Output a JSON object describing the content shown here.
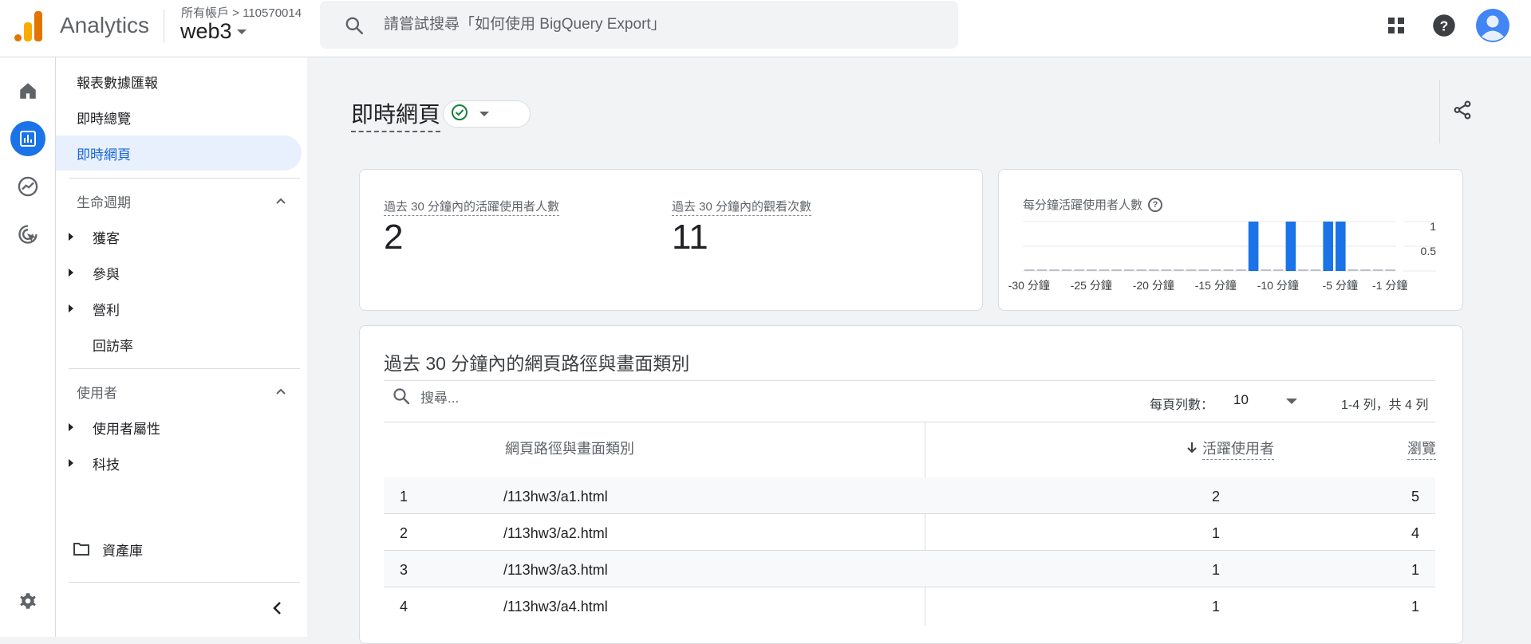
{
  "header": {
    "app_name": "Analytics",
    "account_crumb": "所有帳戶 > 110570014",
    "property_name": "web3",
    "search_placeholder": "請嘗試搜尋「如何使用 BigQuery Export」"
  },
  "colors": {
    "accent": "#1a73e8",
    "active_bg": "#e8f0fe",
    "bar": "#1a73e8",
    "check": "#188038"
  },
  "sidebar": {
    "items": [
      {
        "label": "報表數據匯報"
      },
      {
        "label": "即時總覽"
      },
      {
        "label": "即時網頁"
      }
    ],
    "sections": [
      {
        "label": "生命週期",
        "children": [
          "獲客",
          "參與",
          "營利",
          "回訪率"
        ]
      },
      {
        "label": "使用者",
        "children": [
          "使用者屬性",
          "科技"
        ]
      }
    ],
    "library": "資產庫"
  },
  "page": {
    "title": "即時網頁"
  },
  "metrics": [
    {
      "label": "過去 30 分鐘內的活躍使用者人數",
      "value": "2"
    },
    {
      "label": "過去 30 分鐘內的觀看次數",
      "value": "11"
    }
  ],
  "chart_data": {
    "type": "bar",
    "title": "每分鐘活躍使用者人數",
    "x_tick_labels": [
      "-30 分鐘",
      "-25 分鐘",
      "-20 分鐘",
      "-15 分鐘",
      "-10 分鐘",
      "-5 分鐘",
      "-1 分鐘"
    ],
    "x": [
      -30,
      -29,
      -28,
      -27,
      -26,
      -25,
      -24,
      -23,
      -22,
      -21,
      -20,
      -19,
      -18,
      -17,
      -16,
      -15,
      -14,
      -13,
      -12,
      -11,
      -10,
      -9,
      -8,
      -7,
      -6,
      -5,
      -4,
      -3,
      -2,
      -1
    ],
    "values": [
      0,
      0,
      0,
      0,
      0,
      0,
      0,
      0,
      0,
      0,
      0,
      0,
      0,
      0,
      0,
      0,
      0,
      0,
      1,
      0,
      0,
      1,
      0,
      0,
      1,
      1,
      0,
      0,
      0,
      0
    ],
    "y_tick_labels": [
      "1",
      "0.5"
    ],
    "ylim": [
      0,
      1
    ]
  },
  "table": {
    "title": "過去 30 分鐘內的網頁路徑與畫面類別",
    "search_placeholder": "搜尋...",
    "rows_per_page_label": "每頁列數：",
    "rows_per_page_value": "10",
    "page_info": "1-4 列，共 4 列",
    "columns": [
      "網頁路徑與畫面類別",
      "活躍使用者",
      "瀏覽"
    ],
    "rows": [
      {
        "index": "1",
        "path": "/113hw3/a1.html",
        "users": "2",
        "views": "5"
      },
      {
        "index": "2",
        "path": "/113hw3/a2.html",
        "users": "1",
        "views": "4"
      },
      {
        "index": "3",
        "path": "/113hw3/a3.html",
        "users": "1",
        "views": "1"
      },
      {
        "index": "4",
        "path": "/113hw3/a4.html",
        "users": "1",
        "views": "1"
      }
    ]
  }
}
